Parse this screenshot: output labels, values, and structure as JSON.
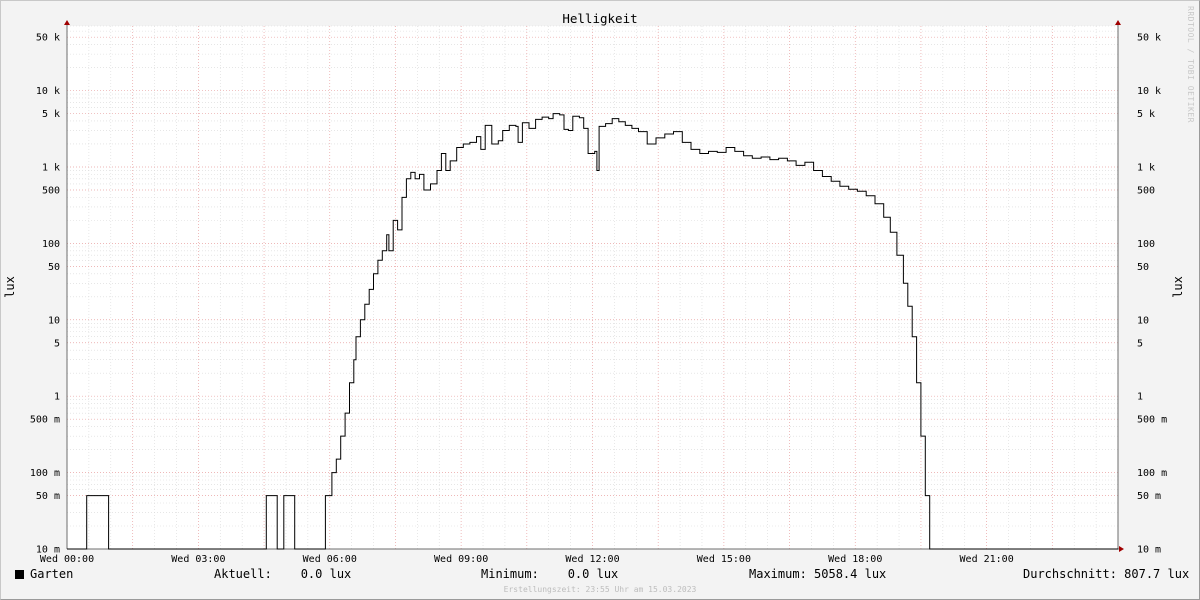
{
  "watermark": "RRDTOOL / TOBI OETIKER",
  "footer": {
    "series_name": "Garten",
    "series_color": "#000000",
    "current": "Aktuell:    0.0 lux",
    "minimum": "Minimum:    0.0 lux",
    "maximum": "Maximum: 5058.4 lux",
    "average": "Durchschnitt: 807.7 lux",
    "created": "Erstellungszeit: 23:55 Uhr am 15.03.2023"
  },
  "chart_data": {
    "type": "line",
    "title": "Helligkeit",
    "ylabel": "lux",
    "ylabel_right": "lux",
    "yscale": "log",
    "ylim": [
      0.01,
      70000
    ],
    "xlim_hours": [
      0,
      24
    ],
    "grid": true,
    "x_ticks": [
      {
        "h": 0,
        "label": "Wed 00:00"
      },
      {
        "h": 3,
        "label": "Wed 03:00"
      },
      {
        "h": 6,
        "label": "Wed 06:00"
      },
      {
        "h": 9,
        "label": "Wed 09:00"
      },
      {
        "h": 12,
        "label": "Wed 12:00"
      },
      {
        "h": 15,
        "label": "Wed 15:00"
      },
      {
        "h": 18,
        "label": "Wed 18:00"
      },
      {
        "h": 21,
        "label": "Wed 21:00"
      }
    ],
    "y_ticks": [
      {
        "v": 50000,
        "label": "50 k"
      },
      {
        "v": 10000,
        "label": "10 k"
      },
      {
        "v": 5000,
        "label": "5 k"
      },
      {
        "v": 1000,
        "label": "1 k"
      },
      {
        "v": 500,
        "label": "500"
      },
      {
        "v": 100,
        "label": "100"
      },
      {
        "v": 50,
        "label": "50"
      },
      {
        "v": 10,
        "label": "10"
      },
      {
        "v": 5,
        "label": "5"
      },
      {
        "v": 1,
        "label": "1"
      },
      {
        "v": 0.5,
        "label": "500 m"
      },
      {
        "v": 0.1,
        "label": "100 m"
      },
      {
        "v": 0.05,
        "label": "50 m"
      },
      {
        "v": 0.01,
        "label": "10 m"
      }
    ],
    "series": [
      {
        "name": "Garten",
        "color": "#000000",
        "points": [
          [
            0.0,
            0.01
          ],
          [
            0.45,
            0.01
          ],
          [
            0.45,
            0.05
          ],
          [
            0.95,
            0.05
          ],
          [
            0.95,
            0.01
          ],
          [
            4.55,
            0.01
          ],
          [
            4.55,
            0.05
          ],
          [
            4.8,
            0.05
          ],
          [
            4.8,
            0.01
          ],
          [
            4.95,
            0.01
          ],
          [
            4.95,
            0.05
          ],
          [
            5.2,
            0.05
          ],
          [
            5.2,
            0.01
          ],
          [
            5.9,
            0.01
          ],
          [
            5.9,
            0.05
          ],
          [
            6.05,
            0.05
          ],
          [
            6.05,
            0.1
          ],
          [
            6.15,
            0.15
          ],
          [
            6.25,
            0.3
          ],
          [
            6.35,
            0.6
          ],
          [
            6.45,
            1.5
          ],
          [
            6.55,
            3
          ],
          [
            6.6,
            6
          ],
          [
            6.7,
            10
          ],
          [
            6.8,
            16
          ],
          [
            6.9,
            25
          ],
          [
            7.0,
            40
          ],
          [
            7.1,
            60
          ],
          [
            7.2,
            80
          ],
          [
            7.3,
            130
          ],
          [
            7.35,
            80
          ],
          [
            7.45,
            200
          ],
          [
            7.55,
            150
          ],
          [
            7.65,
            400
          ],
          [
            7.75,
            700
          ],
          [
            7.85,
            850
          ],
          [
            7.95,
            700
          ],
          [
            8.05,
            800
          ],
          [
            8.15,
            500
          ],
          [
            8.3,
            600
          ],
          [
            8.45,
            900
          ],
          [
            8.55,
            1500
          ],
          [
            8.65,
            900
          ],
          [
            8.75,
            1200
          ],
          [
            8.9,
            1800
          ],
          [
            9.05,
            2000
          ],
          [
            9.2,
            2100
          ],
          [
            9.35,
            2500
          ],
          [
            9.45,
            1700
          ],
          [
            9.55,
            3500
          ],
          [
            9.7,
            2000
          ],
          [
            9.85,
            2200
          ],
          [
            9.95,
            3000
          ],
          [
            10.1,
            3500
          ],
          [
            10.25,
            3400
          ],
          [
            10.3,
            2100
          ],
          [
            10.4,
            3800
          ],
          [
            10.55,
            3200
          ],
          [
            10.7,
            4200
          ],
          [
            10.85,
            4500
          ],
          [
            11.0,
            4300
          ],
          [
            11.1,
            5000
          ],
          [
            11.25,
            4800
          ],
          [
            11.35,
            3100
          ],
          [
            11.45,
            3000
          ],
          [
            11.55,
            4600
          ],
          [
            11.7,
            4400
          ],
          [
            11.8,
            3200
          ],
          [
            11.9,
            1500
          ],
          [
            12.05,
            1600
          ],
          [
            12.1,
            900
          ],
          [
            12.15,
            3400
          ],
          [
            12.3,
            3700
          ],
          [
            12.45,
            4300
          ],
          [
            12.6,
            3900
          ],
          [
            12.75,
            3500
          ],
          [
            12.9,
            3200
          ],
          [
            13.05,
            2900
          ],
          [
            13.25,
            2000
          ],
          [
            13.45,
            2400
          ],
          [
            13.65,
            2700
          ],
          [
            13.85,
            2900
          ],
          [
            14.05,
            2100
          ],
          [
            14.25,
            1700
          ],
          [
            14.45,
            1500
          ],
          [
            14.65,
            1600
          ],
          [
            14.85,
            1550
          ],
          [
            15.05,
            1800
          ],
          [
            15.25,
            1600
          ],
          [
            15.45,
            1400
          ],
          [
            15.65,
            1300
          ],
          [
            15.85,
            1350
          ],
          [
            16.05,
            1250
          ],
          [
            16.25,
            1300
          ],
          [
            16.45,
            1200
          ],
          [
            16.65,
            1050
          ],
          [
            16.85,
            1150
          ],
          [
            17.05,
            900
          ],
          [
            17.25,
            750
          ],
          [
            17.45,
            650
          ],
          [
            17.65,
            560
          ],
          [
            17.85,
            510
          ],
          [
            18.05,
            480
          ],
          [
            18.25,
            420
          ],
          [
            18.45,
            330
          ],
          [
            18.65,
            220
          ],
          [
            18.8,
            140
          ],
          [
            18.95,
            70
          ],
          [
            19.1,
            30
          ],
          [
            19.2,
            15
          ],
          [
            19.3,
            6
          ],
          [
            19.4,
            1.5
          ],
          [
            19.5,
            0.3
          ],
          [
            19.6,
            0.05
          ],
          [
            19.7,
            0.01
          ],
          [
            24.0,
            0.01
          ]
        ]
      }
    ]
  }
}
